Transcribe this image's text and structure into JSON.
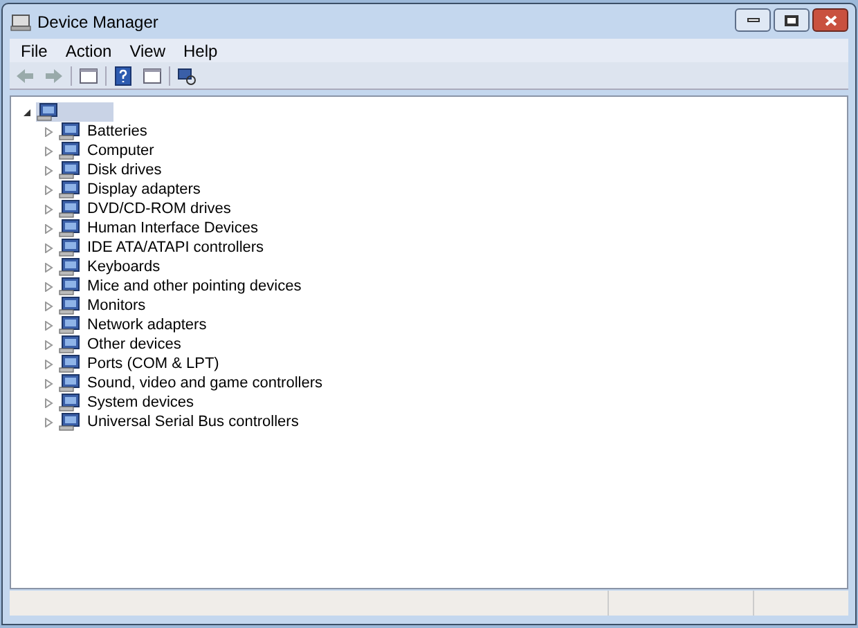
{
  "window": {
    "title": "Device Manager"
  },
  "menu": [
    "File",
    "Action",
    "View",
    "Help"
  ],
  "tree": {
    "expanded": true,
    "selected": true,
    "children": [
      {
        "label": "Batteries",
        "expanded": false
      },
      {
        "label": "Computer",
        "expanded": false
      },
      {
        "label": "Disk drives",
        "expanded": false
      },
      {
        "label": "Display adapters",
        "expanded": false
      },
      {
        "label": "DVD/CD-ROM drives",
        "expanded": false
      },
      {
        "label": "Human Interface Devices",
        "expanded": false
      },
      {
        "label": "IDE ATA/ATAPI controllers",
        "expanded": false
      },
      {
        "label": "Keyboards",
        "expanded": false
      },
      {
        "label": "Mice and other pointing devices",
        "expanded": false
      },
      {
        "label": "Monitors",
        "expanded": false
      },
      {
        "label": "Network adapters",
        "expanded": false
      },
      {
        "label": "Other devices",
        "expanded": false
      },
      {
        "label": "Ports (COM & LPT)",
        "expanded": false
      },
      {
        "label": "Sound, video and game controllers",
        "expanded": false
      },
      {
        "label": "System devices",
        "expanded": false
      },
      {
        "label": "Universal Serial Bus controllers",
        "expanded": false
      }
    ]
  }
}
